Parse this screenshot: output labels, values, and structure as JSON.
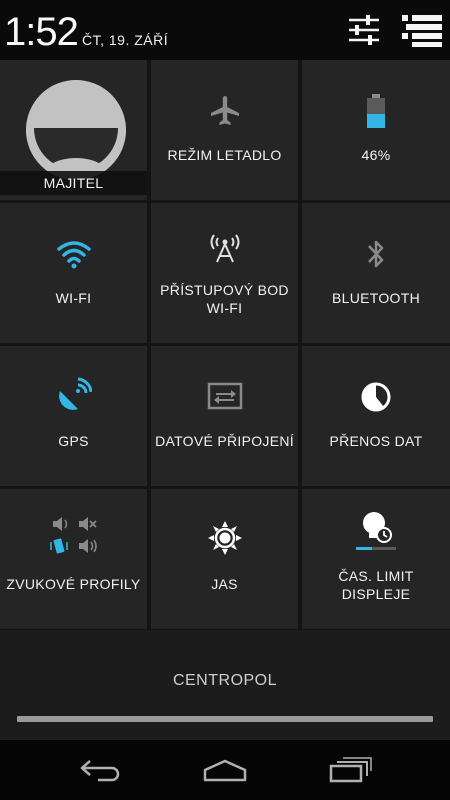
{
  "status": {
    "time": "1:52",
    "date": "ČT, 19. ZÁŘÍ"
  },
  "header": {
    "settings_icon": "settings-sliders-icon",
    "list_icon": "notification-list-icon"
  },
  "tiles": [
    {
      "label": "MAJITEL",
      "icon": "avatar"
    },
    {
      "label": "REŽIM LETADLO",
      "icon": "airplane-icon"
    },
    {
      "label": "46%",
      "icon": "battery-icon",
      "battery_level": 0.46
    },
    {
      "label": "WI-FI",
      "icon": "wifi-icon"
    },
    {
      "label": "PŘÍSTUPOVÝ BOD\nWI-FI",
      "line1": "PŘÍSTUPOVÝ BOD",
      "line2": "WI-FI",
      "icon": "hotspot-icon"
    },
    {
      "label": "BLUETOOTH",
      "icon": "bluetooth-icon"
    },
    {
      "label": "GPS",
      "icon": "gps-icon"
    },
    {
      "label": "DATOVÉ PŘIPOJENÍ",
      "icon": "data-connection-icon"
    },
    {
      "label": "PŘENOS DAT",
      "icon": "data-transfer-icon"
    },
    {
      "label": "ZVUKOVÉ PROFILY",
      "icon": "sound-profiles-icon"
    },
    {
      "label": "JAS",
      "icon": "brightness-icon"
    },
    {
      "label": "ČAS. LIMIT\nDISPLEJE",
      "line1": "ČAS. LIMIT",
      "line2": "DISPLEJE",
      "icon": "screen-timeout-icon"
    }
  ],
  "carrier": "CENTROPOL",
  "colors": {
    "accent": "#33b5e5",
    "tile": "#252525",
    "background": "#0d0d0d"
  },
  "nav": {
    "back": "back-icon",
    "home": "home-icon",
    "recents": "recents-icon"
  }
}
